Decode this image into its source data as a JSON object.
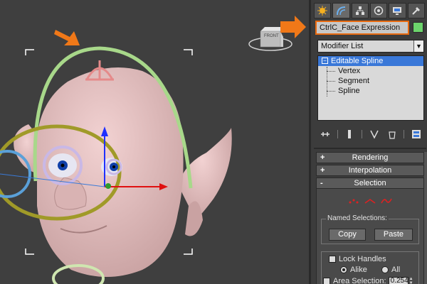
{
  "viewport": {
    "viewcube_label": "FRONT"
  },
  "toolbar_tabs": [
    {
      "name": "create-tab-icon",
      "active": false
    },
    {
      "name": "modify-tab-icon",
      "active": true
    },
    {
      "name": "hierarchy-tab-icon",
      "active": false
    },
    {
      "name": "motion-tab-icon",
      "active": false
    },
    {
      "name": "display-tab-icon",
      "active": false
    },
    {
      "name": "utilities-tab-icon",
      "active": false
    }
  ],
  "object": {
    "name": "CtrlC_Face Expression",
    "color": "#6cd46c"
  },
  "modifier_list": {
    "label": "Modifier List"
  },
  "stack": {
    "base": "Editable Spline",
    "subobjects": [
      "Vertex",
      "Segment",
      "Spline"
    ]
  },
  "rollouts": {
    "rendering": "Rendering",
    "interpolation": "Interpolation",
    "selection": "Selection",
    "rendering_pm": "+",
    "interpolation_pm": "+",
    "selection_pm": "-"
  },
  "selection": {
    "named_selections_label": "Named Selections:",
    "copy_label": "Copy",
    "paste_label": "Paste",
    "lock_handles_label": "Lock Handles",
    "alike_label": "Alike",
    "all_label": "All",
    "area_selection_label": "Area Selection:",
    "area_selection_value": "0.254"
  },
  "colors": {
    "accent_orange": "#e86a10",
    "selection_blue": "#3a78d8",
    "arc_green": "#a8d88a",
    "ring_yellow": "#a09a28"
  }
}
